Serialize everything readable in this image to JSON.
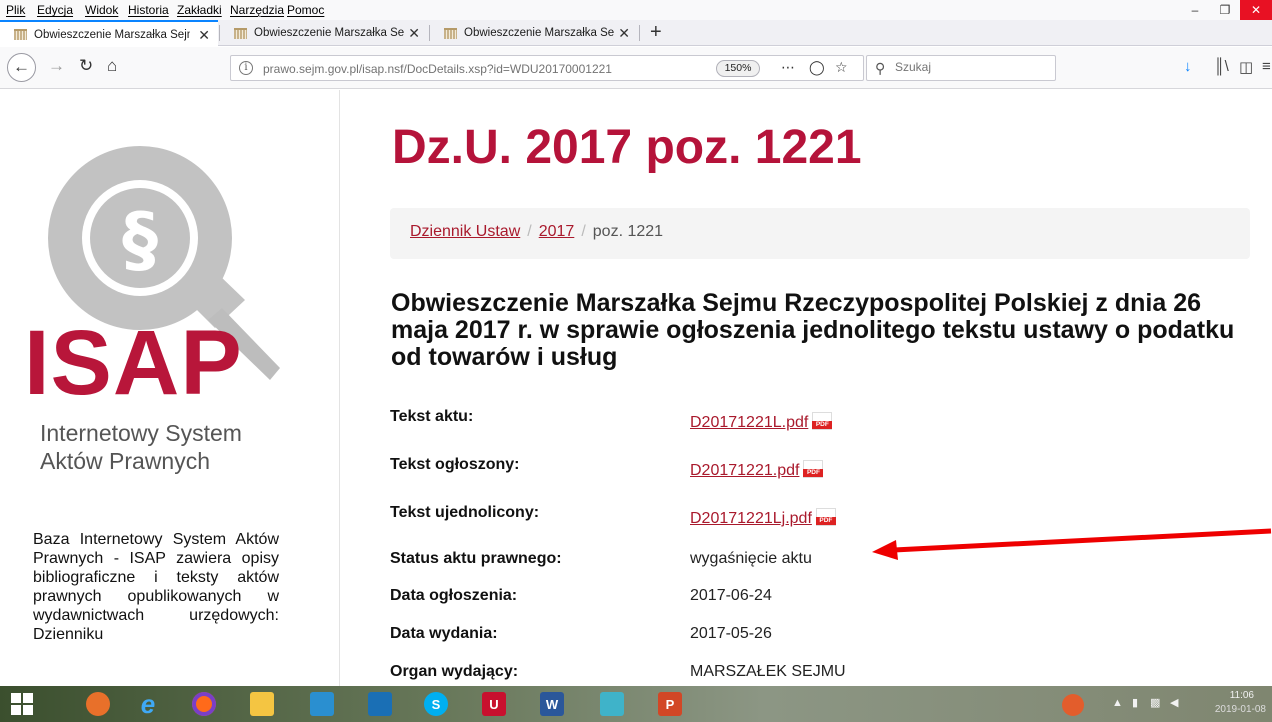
{
  "menubar": {
    "items": [
      "Plik",
      "Edycja",
      "Widok",
      "Historia",
      "Zakładki",
      "Narzędzia",
      "Pomoc"
    ]
  },
  "tabs": [
    {
      "label": "Obwieszczenie Marszałka Sejmu"
    },
    {
      "label": "Obwieszczenie Marszałka Sejmu"
    },
    {
      "label": "Obwieszczenie Marszałka Sejmu"
    }
  ],
  "navbar": {
    "url": "prawo.sejm.gov.pl/isap.nsf/DocDetails.xsp?id=WDU20170001221",
    "zoom": "150%",
    "search_placeholder": "Szukaj"
  },
  "sidebar": {
    "logo_text": "ISAP",
    "logo_sub_line1": "Internetowy System",
    "logo_sub_line2": "Aktów Prawnych",
    "description": "Baza Internetowy System Aktów Prawnych - ISAP zawiera opisy bibliograficzne i teksty aktów prawnych opublikowanych w wydawnictwach urzędowych: Dzienniku"
  },
  "main": {
    "page_title": "Dz.U. 2017 poz. 1221",
    "breadcrumb": {
      "item1": "Dziennik Ustaw",
      "item2": "2017",
      "current": "poz. 1221"
    },
    "doc_title": "Obwieszczenie Marszałka Sejmu Rzeczypospolitej Polskiej z dnia 26 maja 2017 r. w sprawie ogłoszenia jednolitego tekstu ustawy o podatku od towarów i usług",
    "meta": {
      "tekst_aktu_label": "Tekst aktu:",
      "tekst_aktu_value": "D20171221L.pdf",
      "tekst_ogloszony_label": "Tekst ogłoszony:",
      "tekst_ogloszony_value": "D20171221.pdf",
      "tekst_ujednolicony_label": "Tekst ujednolicony:",
      "tekst_ujednolicony_value": "D20171221Lj.pdf",
      "status_label": "Status aktu prawnego:",
      "status_value": "wygaśnięcie aktu",
      "data_ogloszenia_label": "Data ogłoszenia:",
      "data_ogloszenia_value": "2017-06-24",
      "data_wydania_label": "Data wydania:",
      "data_wydania_value": "2017-05-26",
      "organ_label": "Organ wydający:",
      "organ_value": "MARSZAŁEK SEJMU"
    }
  },
  "taskbar": {
    "clock_time": "11:06",
    "clock_date": "2019-01-08"
  },
  "colors": {
    "brand_red": "#b5133a",
    "link_red": "#a9192c",
    "arrow_red": "#ee0000",
    "firefox_blue": "#0a84ff"
  }
}
